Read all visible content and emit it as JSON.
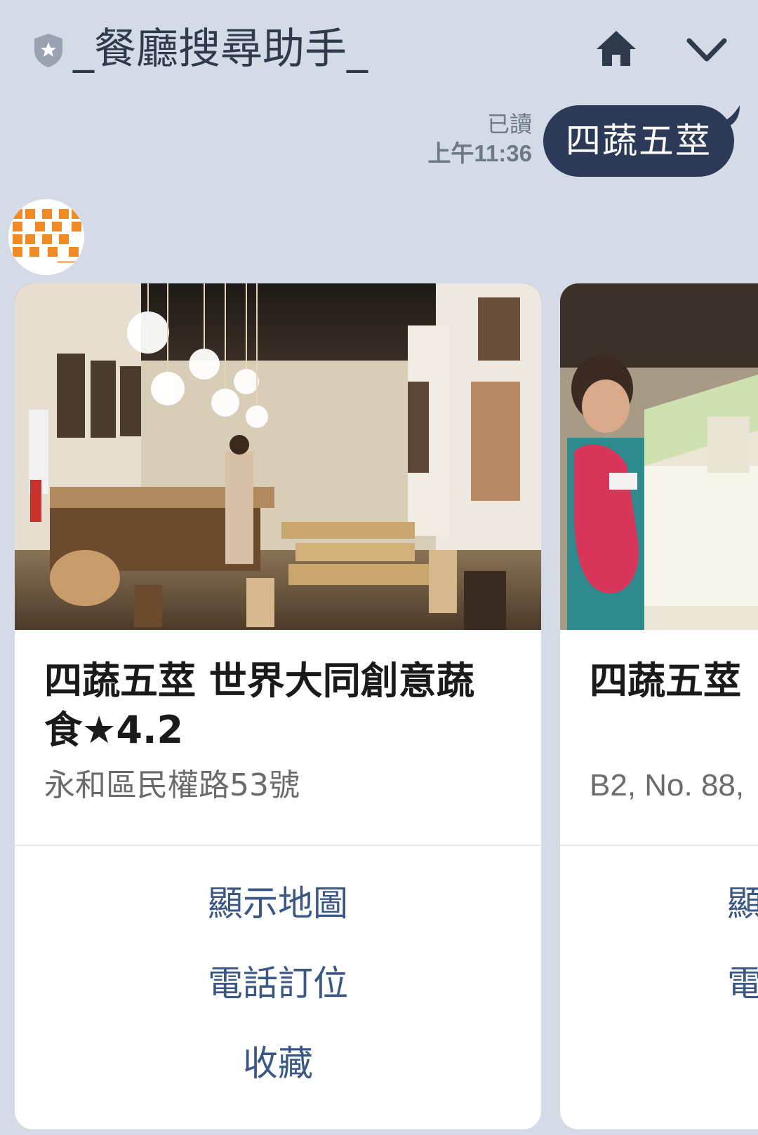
{
  "header": {
    "title": "_餐廳搜尋助手_",
    "shield_icon": "shield-star-icon",
    "home_icon": "home-icon",
    "collapse_icon": "chevron-down-icon"
  },
  "sent_message": {
    "read_label": "已讀",
    "time": "上午11:36",
    "text": "四蔬五莖"
  },
  "cards": [
    {
      "title": "四蔬五莖 世界大同創意蔬食★4.2",
      "address": "永和區民權路53號",
      "actions": [
        "顯示地圖",
        "電話訂位",
        "收藏"
      ]
    },
    {
      "title": "四蔬五莖 ",
      "address": "B2, No. 88,",
      "actions": [
        "顯",
        "電"
      ]
    }
  ],
  "colors": {
    "background": "#d5dbe6",
    "bubble": "#2c3a57",
    "action_text": "#3a5785",
    "avatar_accent": "#f08a24"
  }
}
